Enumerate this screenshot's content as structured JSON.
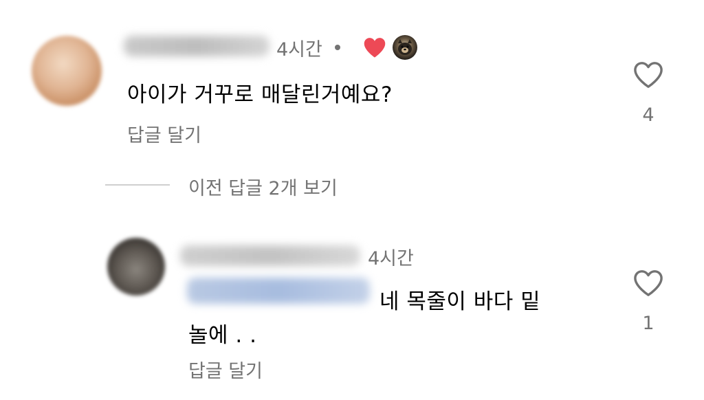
{
  "comment": {
    "time": "4시간",
    "text": "아이가 거꾸로 매달린거예요?",
    "reply_action": "답글 달기",
    "like_count": "4",
    "liked_by_author_icon": "heart-filled-red",
    "accent_heart_color": "#ed4956"
  },
  "thread": {
    "view_replies_label": "이전 답글 2개 보기"
  },
  "reply": {
    "time": "4시간",
    "text_line1": "네 목줄이 바다 밑",
    "text_line2": "놀에 . .",
    "reply_action": "답글 달기",
    "like_count": "1"
  },
  "icons": {
    "like": "heart-outline-icon"
  }
}
